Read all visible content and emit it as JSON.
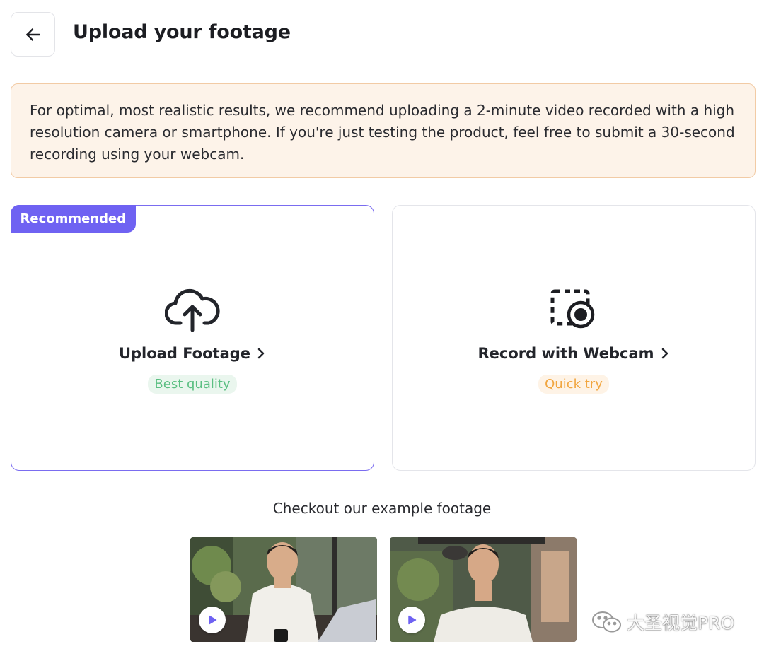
{
  "header": {
    "title": "Upload your footage",
    "back_icon": "arrow-left-icon"
  },
  "notice": {
    "text": "For optimal, most realistic results, we recommend uploading a 2-minute video recorded with a high resolution camera or smartphone. If you're just testing the product, feel free to submit a 30-second recording using your webcam."
  },
  "options": {
    "upload": {
      "badge": "Recommended",
      "label": "Upload Footage",
      "tag": "Best quality",
      "icon": "cloud-upload-icon"
    },
    "webcam": {
      "label": "Record with Webcam",
      "tag": "Quick try",
      "icon": "webcam-record-icon"
    }
  },
  "examples": {
    "title": "Checkout our example footage",
    "items": [
      {
        "icon": "play-icon"
      },
      {
        "icon": "play-icon"
      }
    ]
  },
  "watermark": {
    "text": "大圣视觉PRO",
    "icon": "wechat-icon"
  },
  "colors": {
    "accent": "#6f62f2",
    "notice_bg": "#fdf3e9",
    "notice_border": "#f2cba5",
    "tag_green": "#5bbf82",
    "tag_orange": "#f1a640"
  }
}
